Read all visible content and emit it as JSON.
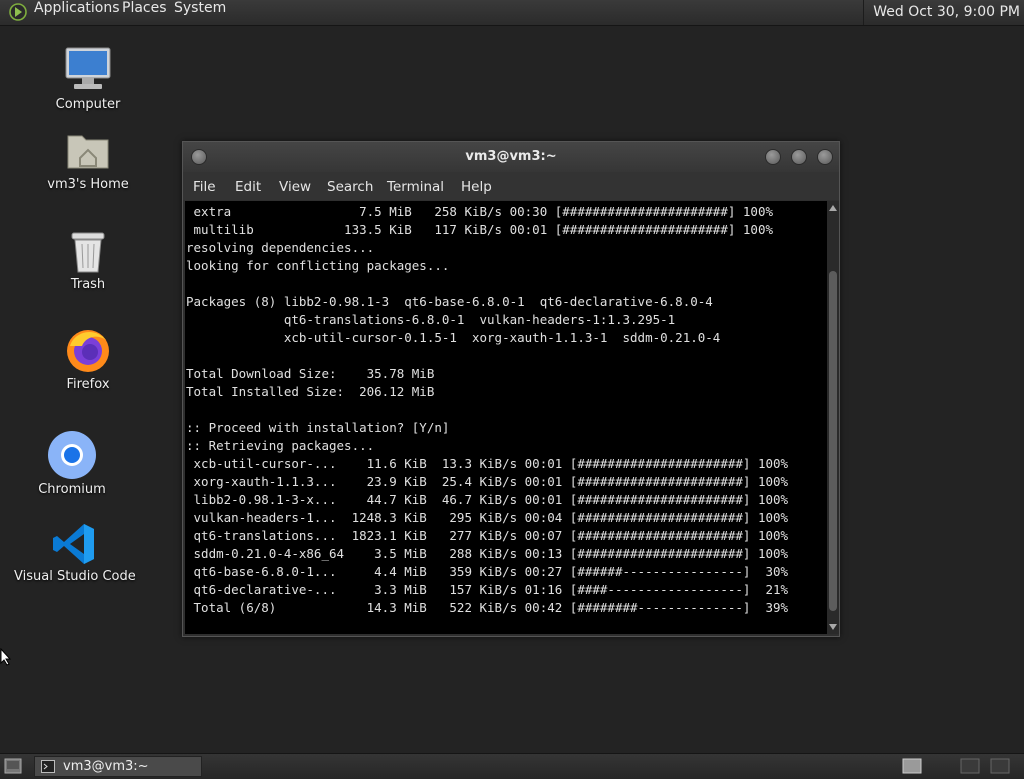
{
  "top_panel": {
    "menus": [
      "Applications",
      "Places",
      "System"
    ],
    "clock": "Wed Oct 30,  9:00 PM"
  },
  "desktop_icons": [
    {
      "label": "Computer",
      "icon": "computer-icon"
    },
    {
      "label": "vm3's Home",
      "icon": "home-folder-icon"
    },
    {
      "label": "Trash",
      "icon": "trash-icon"
    },
    {
      "label": "Firefox",
      "icon": "firefox-icon"
    },
    {
      "label": "Chromium",
      "icon": "chromium-icon"
    },
    {
      "label": "Visual Studio Code",
      "icon": "vscode-icon"
    }
  ],
  "terminal": {
    "title": "vm3@vm3:~",
    "menu": [
      "File",
      "Edit",
      "View",
      "Search",
      "Terminal",
      "Help"
    ],
    "lines": [
      " extra                 7.5 MiB   258 KiB/s 00:30 [######################] 100%",
      " multilib            133.5 KiB   117 KiB/s 00:01 [######################] 100%",
      "resolving dependencies...",
      "looking for conflicting packages...",
      "",
      "Packages (8) libb2-0.98.1-3  qt6-base-6.8.0-1  qt6-declarative-6.8.0-4",
      "             qt6-translations-6.8.0-1  vulkan-headers-1:1.3.295-1",
      "             xcb-util-cursor-0.1.5-1  xorg-xauth-1.1.3-1  sddm-0.21.0-4",
      "",
      "Total Download Size:    35.78 MiB",
      "Total Installed Size:  206.12 MiB",
      "",
      ":: Proceed with installation? [Y/n]",
      ":: Retrieving packages...",
      " xcb-util-cursor-...    11.6 KiB  13.3 KiB/s 00:01 [######################] 100%",
      " xorg-xauth-1.1.3...    23.9 KiB  25.4 KiB/s 00:01 [######################] 100%",
      " libb2-0.98.1-3-x...    44.7 KiB  46.7 KiB/s 00:01 [######################] 100%",
      " vulkan-headers-1...  1248.3 KiB   295 KiB/s 00:04 [######################] 100%",
      " qt6-translations...  1823.1 KiB   277 KiB/s 00:07 [######################] 100%",
      " sddm-0.21.0-4-x86_64    3.5 MiB   288 KiB/s 00:13 [######################] 100%",
      " qt6-base-6.8.0-1...     4.4 MiB   359 KiB/s 00:27 [######----------------]  30%",
      " qt6-declarative-...     3.3 MiB   157 KiB/s 01:16 [####------------------]  21%",
      " Total (6/8)            14.3 MiB   522 KiB/s 00:42 [########--------------]  39%"
    ]
  },
  "taskbar": {
    "window_button": "vm3@vm3:~"
  },
  "colors": {
    "desktop_bg": "#232323",
    "terminal_bg": "#000000",
    "terminal_fg": "#e0e0e0",
    "chromium_blue": "#1a73e8",
    "vscode_blue": "#0a7ad4",
    "firefox_orange": "#ff7a1a"
  }
}
